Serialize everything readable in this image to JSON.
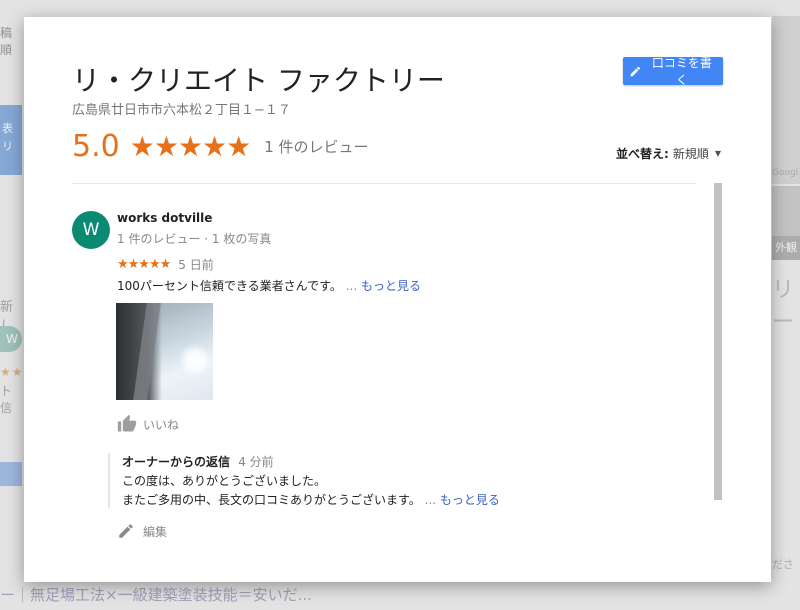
{
  "background": {
    "top_left_text": "稿順",
    "blue_block_text": "表\nリ",
    "label_new": "新し",
    "avatar_letter": "W",
    "stars": "★★",
    "small_text": "ト信",
    "bottom_text": "ー｜無足場工法×一級建築塗装技能＝安いだ...",
    "map_label": "Googl",
    "gaikan_label": "外観",
    "right_title": "リー",
    "right_bottom": "ださ"
  },
  "dialog": {
    "title": "リ・クリエイト ファクトリー",
    "address": "広島県廿日市市六本松２丁目１−１７",
    "write_review_label": "口コミを書く",
    "rating": "5.0",
    "stars": "★★★★★",
    "review_count": "1 件のレビュー",
    "sort_label": "並べ替え:",
    "sort_value": "新規順"
  },
  "review": {
    "avatar_letter": "W",
    "reviewer_name": "works dotville",
    "reviewer_meta": "1 件のレビュー · 1 枚の写真",
    "stars": "★★★★★",
    "date": "5 日前",
    "text": "100パーセント信頼できる業者さんです。",
    "ellipsis": "...",
    "more_link": "もっと見る",
    "like_label": "いいね",
    "owner_reply": {
      "heading": "オーナーからの返信",
      "time": "4 分前",
      "line1": "この度は、ありがとうございました。",
      "line2": "またご多用の中、長文の口コミありがとうございます。",
      "ellipsis": "...",
      "more_link": "もっと見る"
    },
    "edit_label": "編集"
  },
  "colors": {
    "accent_orange": "#e7711b",
    "button_blue": "#4285f4",
    "link_blue": "#3a5fc0",
    "avatar_green": "#0a8a72"
  },
  "icons": [
    "pencil-icon",
    "thumbs-up-icon",
    "edit-pencil-icon",
    "dropdown-caret-icon"
  ]
}
